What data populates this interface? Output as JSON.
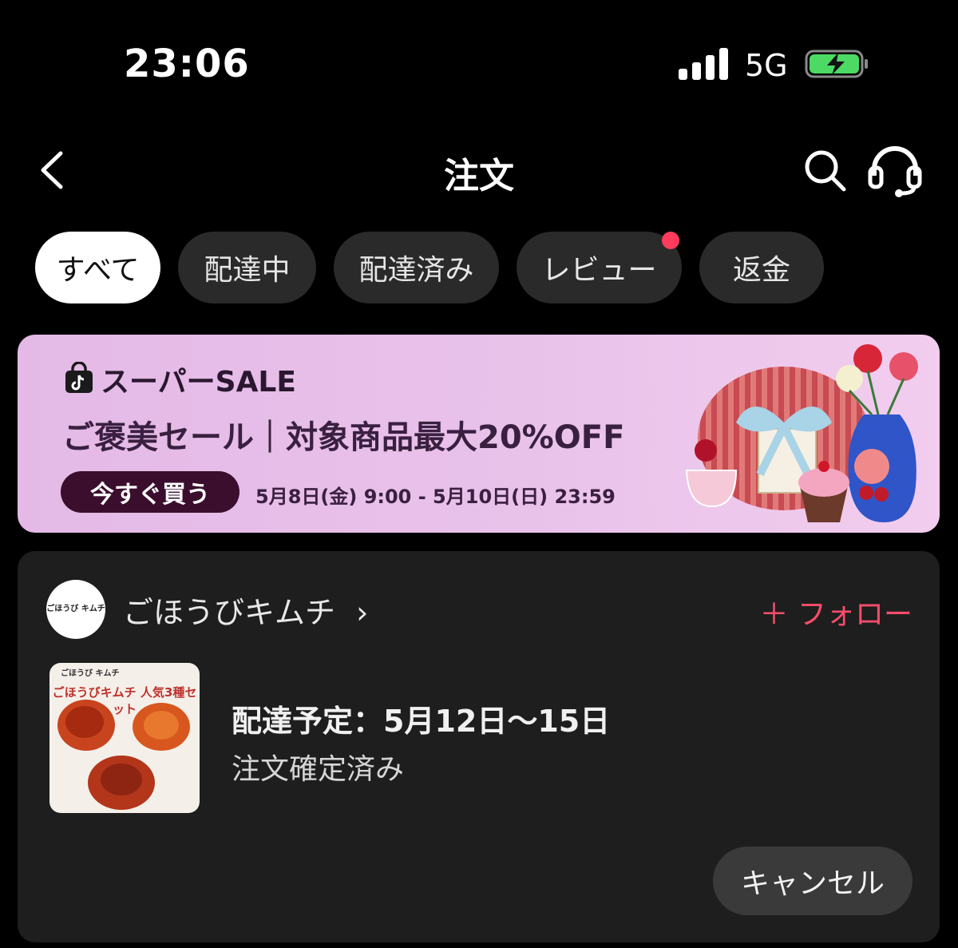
{
  "status_bar": {
    "time": "23:06",
    "network": "5G"
  },
  "header": {
    "title": "注文"
  },
  "tabs": [
    {
      "label": "すべて",
      "active": true
    },
    {
      "label": "配達中",
      "active": false
    },
    {
      "label": "配達済み",
      "active": false
    },
    {
      "label": "レビュー",
      "active": false,
      "badge": true
    },
    {
      "label": "返金",
      "active": false
    }
  ],
  "banner": {
    "title": "スーパーSALE",
    "subtitle": "ご褒美セール｜対象商品最大20%OFF",
    "button": "今すぐ買う",
    "period": "5月8日(金) 9:00 - 5月10日(日) 23:59"
  },
  "order": {
    "shop_name": "ごほうびキムチ",
    "shop_arrow": "›",
    "follow_label": "＋ フォロー",
    "avatar_text": "ごほうび キムチ",
    "product_brand": "ごほうび キムチ",
    "product_title": "ごほうびキムチ 人気3種セット",
    "delivery": "配達予定：5月12日〜15日",
    "status": "注文確定済み",
    "cancel_label": "キャンセル"
  },
  "colors": {
    "background": "#000000",
    "card": "#1e1e1e",
    "accent": "#ff4d6a",
    "banner": "#e6bce8"
  }
}
